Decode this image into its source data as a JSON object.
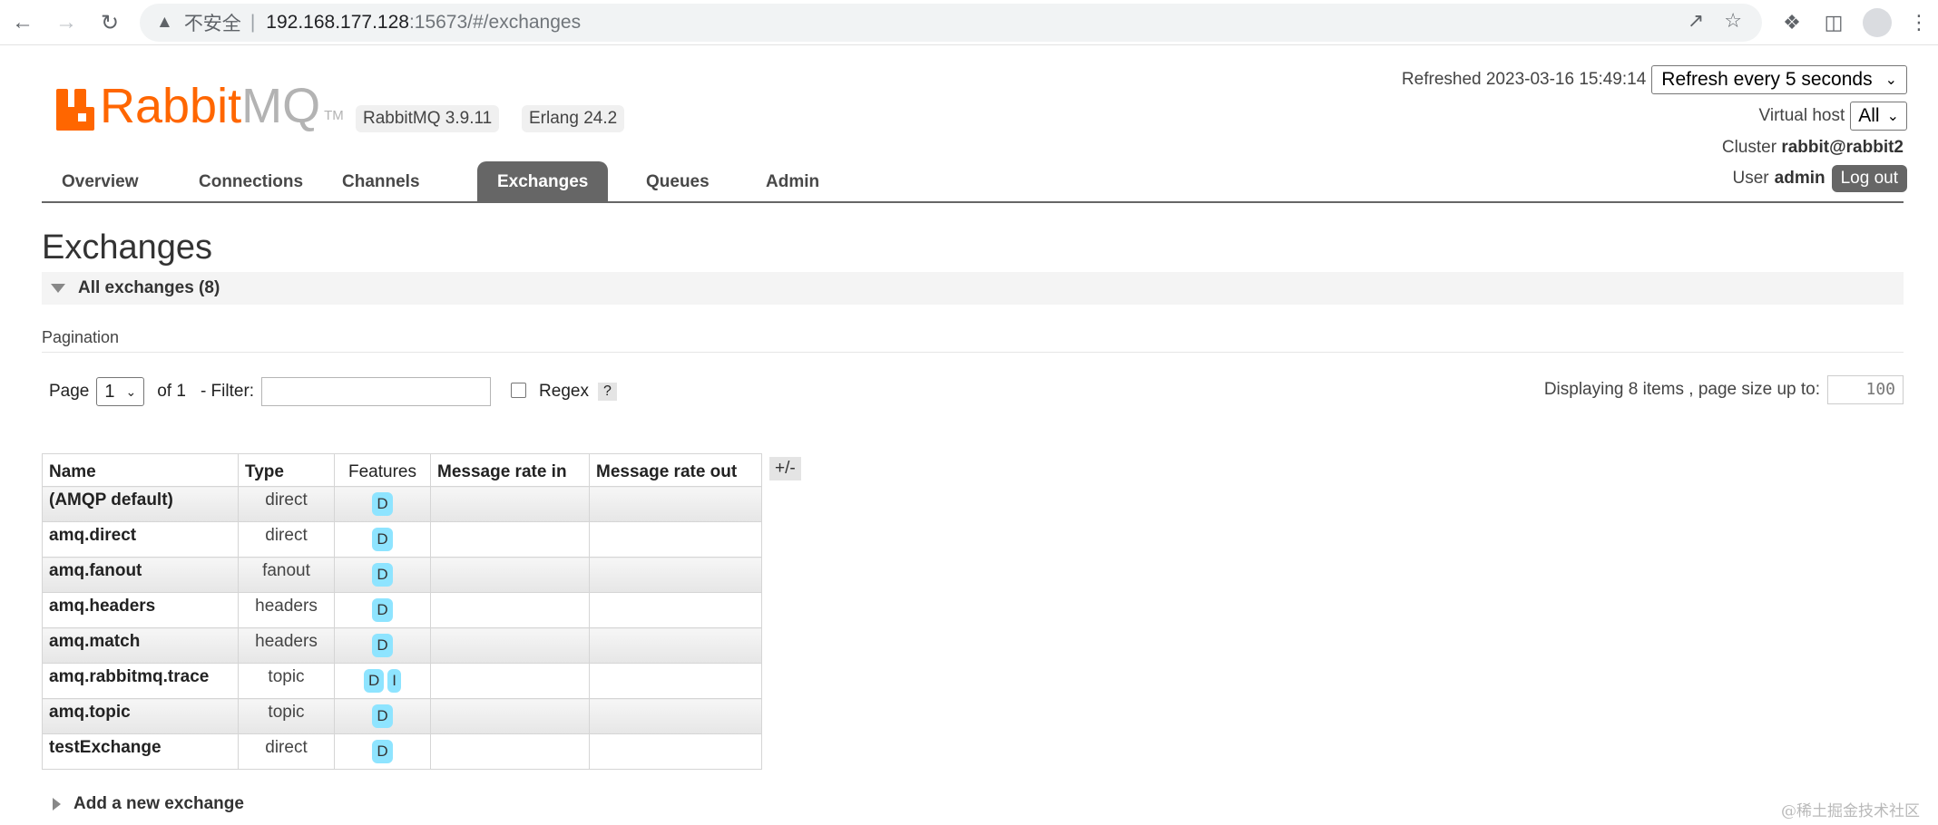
{
  "browser": {
    "insecure_label": "不安全",
    "separator": "|",
    "url_host": "192.168.177.128",
    "url_path": ":15673/#/exchanges"
  },
  "header": {
    "logo_rabbit": "Rabbit",
    "logo_mq": "MQ",
    "logo_tm": "TM",
    "rabbitmq_version": "RabbitMQ 3.9.11",
    "erlang_version": "Erlang 24.2",
    "refreshed_label": "Refreshed 2023-03-16 15:49:14",
    "refresh_select": "Refresh every 5 seconds",
    "vhost_label": "Virtual host",
    "vhost_select": "All",
    "cluster_label": "Cluster",
    "cluster_value": "rabbit@rabbit2",
    "user_label": "User",
    "user_value": "admin",
    "logout_label": "Log out"
  },
  "tabs": [
    {
      "label": "Overview"
    },
    {
      "label": "Connections"
    },
    {
      "label": "Channels"
    },
    {
      "label": "Exchanges",
      "active": true
    },
    {
      "label": "Queues"
    },
    {
      "label": "Admin"
    }
  ],
  "page": {
    "title": "Exchanges",
    "section_label": "All exchanges (8)",
    "pagination_label": "Pagination",
    "page_label": "Page",
    "page_select": "1",
    "of_label": "of 1",
    "filter_label": "- Filter:",
    "regex_label": "Regex",
    "help_label": "?",
    "display_info": "Displaying 8 items , page size up to:",
    "page_size": "100",
    "plus_minus": "+/-",
    "add_exchange_label": "Add a new exchange"
  },
  "table": {
    "headers": [
      "Name",
      "Type",
      "Features",
      "Message rate in",
      "Message rate out"
    ],
    "rows": [
      {
        "name": "(AMQP default)",
        "type": "direct",
        "features": [
          "D"
        ]
      },
      {
        "name": "amq.direct",
        "type": "direct",
        "features": [
          "D"
        ]
      },
      {
        "name": "amq.fanout",
        "type": "fanout",
        "features": [
          "D"
        ]
      },
      {
        "name": "amq.headers",
        "type": "headers",
        "features": [
          "D"
        ]
      },
      {
        "name": "amq.match",
        "type": "headers",
        "features": [
          "D"
        ]
      },
      {
        "name": "amq.rabbitmq.trace",
        "type": "topic",
        "features": [
          "D",
          "I"
        ]
      },
      {
        "name": "amq.topic",
        "type": "topic",
        "features": [
          "D"
        ]
      },
      {
        "name": "testExchange",
        "type": "direct",
        "features": [
          "D"
        ]
      }
    ]
  },
  "watermark": "@稀土掘金技术社区",
  "colors": {
    "brand_orange": "#ff6600",
    "tab_active": "#666666",
    "feature_badge": "#8ee4ff"
  }
}
